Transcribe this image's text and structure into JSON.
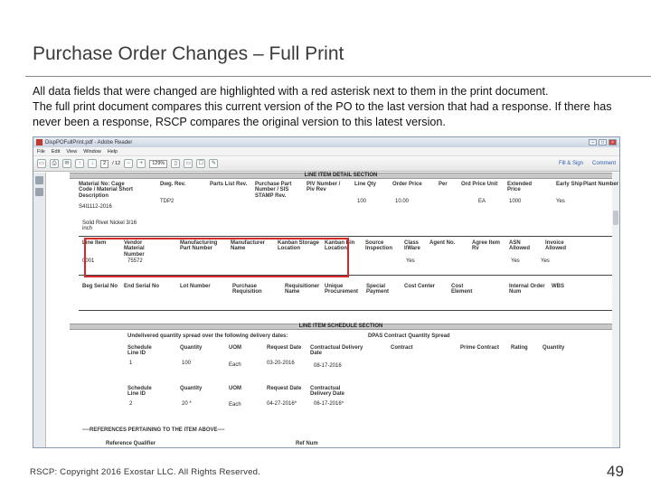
{
  "slide": {
    "title": "Purchase Order Changes – Full Print",
    "para1": "All data fields that were changed are highlighted with a red asterisk next to them in the print document.",
    "para2": "The full print document compares this current version of the PO to the last version that had a response.  If there has never been a response, RSCP compares the original version to this latest version.",
    "footer": "RSCP:  Copyright 2016 Exostar LLC. All Rights Reserved.",
    "page_number": "49"
  },
  "window": {
    "title": "DispPOFullPrint.pdf - Adobe Reader",
    "menu": [
      "File",
      "Edit",
      "View",
      "Window",
      "Help"
    ],
    "page_current": "2",
    "page_total": "/ 12",
    "zoom": "129%",
    "fill_sign": "Fill & Sign",
    "comment": "Comment"
  },
  "doc": {
    "line_item_detail": "LINE ITEM DETAIL SECTION",
    "row1_headers": [
      "Material No: Cage Code / Material Short Description",
      "Dwg. Rev.",
      "Parts List Rev.",
      "Purchase Part Number / SIS STAMP Rev.",
      "PIV Number / Piv Rev",
      "Line Qty",
      "Order Price",
      "Per",
      "Ord Price Unit",
      "Extended Price",
      "Early Ship",
      "Plant Number"
    ],
    "row1_values": {
      "material": "S4I1112-2016",
      "cage": "TDP2",
      "qty": "100",
      "price": "10.00",
      "unit": "EA",
      "extended": "1000",
      "early_ship": "Yes"
    },
    "material_desc": "Solid Rivet Nickel  3/16 inch",
    "row2_headers": [
      "Line Item",
      "Vendor Material Number",
      "Manufacturing Part Number",
      "Manufacturer Name",
      "Kanban Storage Location",
      "Kanban Bin Location",
      "Source Inspection",
      "Class I/Ware",
      "Agent No.",
      "Agree Item Rv",
      "ASN Allowed",
      "Invoice Allowed"
    ],
    "row2_values": {
      "line_item": "0001",
      "vendor_material": "75572",
      "class": "Yes",
      "asn": "Yes",
      "invoice": "Yes"
    },
    "row3_headers": [
      "Beg Serial No",
      "End Serial No",
      "Lot Number",
      "Purchase Requisition",
      "Requisitioner Name",
      "Unique Procurement",
      "Special Payment",
      "Cost Center",
      "Cost Element",
      "Internal Order Num",
      "WBS"
    ],
    "schedule_section": "LINE ITEM SCHEDULE SECTION",
    "undelivered": "Undelivered quantity spread over the following delivery dates:",
    "dpas": "DPAS Contract Quantity Spread",
    "sched_headers": [
      "Schedule Line ID",
      "Quantity",
      "UOM",
      "Request Date",
      "Contractual Delivery Date",
      "Contract",
      "Prime Contract",
      "Rating",
      "Quantity"
    ],
    "sched_row1": [
      "1",
      "100",
      "Each",
      "03-20-2016",
      "08-17-2016"
    ],
    "sched_headers2": [
      "Schedule Line ID",
      "Quantity",
      "UOM",
      "Request Date",
      "Contractual Delivery Date"
    ],
    "sched_row2": [
      "2",
      "20 *",
      "Each",
      "04-27-2016*",
      "06-17-2016*"
    ],
    "references": "----REFERENCES PERTAINING TO THE ITEM ABOVE----",
    "ref_qualifier": "Reference Qualifier",
    "ref_num": "Ref Num"
  }
}
